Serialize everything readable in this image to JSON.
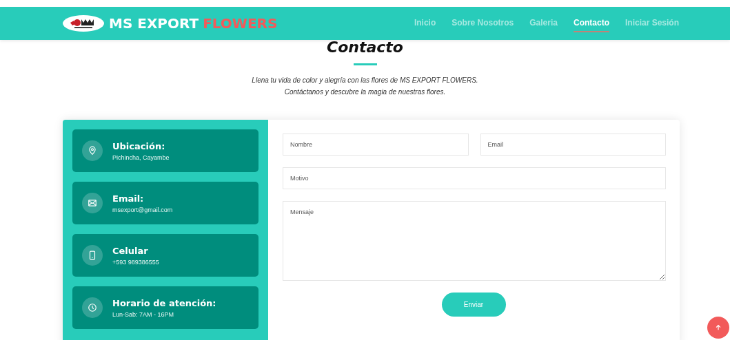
{
  "header": {
    "brand_main": "MS EXPORT",
    "brand_accent": "FLOWERS",
    "nav": [
      {
        "label": "Inicio",
        "selected": false
      },
      {
        "label": "Sobre Nosotros",
        "selected": false
      },
      {
        "label": "Galeria",
        "selected": false
      },
      {
        "label": "Contacto",
        "selected": true
      },
      {
        "label": "Iniciar Sesión",
        "selected": false
      }
    ]
  },
  "section": {
    "title": "Contacto",
    "subtitle_lines": [
      "Llena tu vida de color y alegría con las flores de MS EXPORT FLOWERS.",
      "Contáctanos y descubre la magia de nuestras flores."
    ]
  },
  "info_cards": [
    {
      "kind": "location",
      "title": "Ubicación:",
      "text": "Pichincha, Cayambe"
    },
    {
      "kind": "email",
      "title": "Email:",
      "text": "msexport@gmail.com"
    },
    {
      "kind": "phone",
      "title": "Celular",
      "text": "+593 989386555"
    },
    {
      "kind": "clock",
      "title": "Horario de atención:",
      "text": "Lun-Sab: 7AM - 16PM"
    }
  ],
  "form": {
    "name": {
      "placeholder": "Nombre"
    },
    "email": {
      "placeholder": "Email"
    },
    "subject": {
      "placeholder": "Motivo"
    },
    "message": {
      "placeholder": "Mensaje"
    },
    "submit": "Enviar"
  }
}
